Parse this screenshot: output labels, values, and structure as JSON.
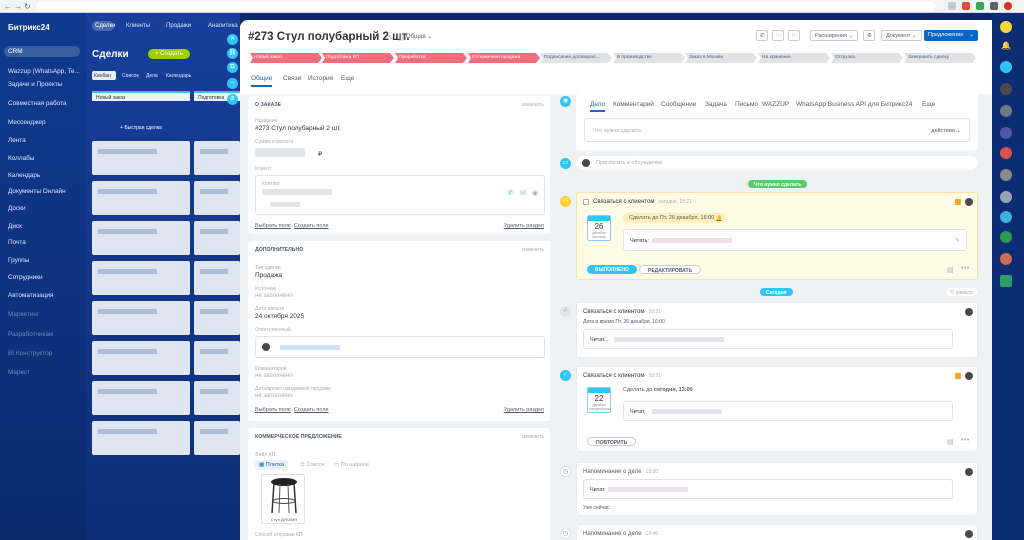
{
  "browser": {
    "nav_back": "←",
    "nav_forward": "→",
    "nav_reload": "↻"
  },
  "sidebar": {
    "logo": "Битрикс24",
    "items": [
      {
        "label": "CRM",
        "active": true
      },
      {
        "label": "Wazzup (WhatsApp, Te..."
      },
      {
        "label": "Задачи и Проекты"
      },
      {
        "label": "Совместная работа"
      },
      {
        "label": "Мессенджер"
      },
      {
        "label": "Лента"
      },
      {
        "label": "Коллабы"
      },
      {
        "label": "Календарь"
      },
      {
        "label": "Документы Онлайн"
      },
      {
        "label": "Доски"
      },
      {
        "label": "Диск"
      },
      {
        "label": "Почта"
      },
      {
        "label": "Группы"
      },
      {
        "label": "Сотрудники"
      },
      {
        "label": "Автоматизация"
      },
      {
        "label": "Маркетинг"
      },
      {
        "label": "Разработчикам"
      },
      {
        "label": "BI Конструктор"
      },
      {
        "label": "Маркет"
      }
    ]
  },
  "crm_bg": {
    "tabs": [
      "Сделки",
      "Клиенты",
      "Продажи",
      "Аналитика"
    ],
    "page_title": "Сделки",
    "create_button": "+ Создать",
    "views": [
      "Канбан",
      "Список",
      "Дела",
      "Календарь"
    ],
    "columns": [
      "Новый заказ",
      "Подготовка"
    ],
    "quick_deal": "+ Быстрая сделка"
  },
  "header": {
    "title": "#273 Стул полубарный 2 шт.",
    "category": "Общая",
    "expansion_label": "Расширения",
    "document_label": "Документ",
    "proposal_label": "Предложение"
  },
  "stages": [
    {
      "label": "Новый заказ",
      "state": "done"
    },
    {
      "label": "Подготовка КП",
      "state": "done"
    },
    {
      "label": "Проработка",
      "state": "done"
    },
    {
      "label": "Отложенная продажа",
      "state": "done"
    },
    {
      "label": "Подписание договора/с...",
      "state": "todo"
    },
    {
      "label": "В производстве",
      "state": "todo"
    },
    {
      "label": "Заказ в Москве",
      "state": "todo"
    },
    {
      "label": "На хранении",
      "state": "todo"
    },
    {
      "label": "Отгрузка",
      "state": "todo"
    },
    {
      "label": "Завершить сделку",
      "state": "todo"
    }
  ],
  "tabs": [
    "Общие",
    "Связи",
    "История",
    "Еще"
  ],
  "about": {
    "title": "О заказе",
    "edit": "изменить",
    "name_label": "Название",
    "name_value": "#273 Стул полубарный 2 шт.",
    "sum_label": "Сумма и валюта",
    "currency": "₽",
    "client_label": "Клиент",
    "contact_label": "Контакт",
    "select_field": "Выбрать поле",
    "create_field": "Создать поле",
    "delete_section": "Удалить раздел"
  },
  "extra": {
    "title": "Дополнительно",
    "edit": "изменить",
    "type_label": "Тип сделки",
    "type_value": "Продажа",
    "source_label": "Источник",
    "empty": "не заполнено",
    "start_label": "Дата начала",
    "start_value": "24 октября 2025",
    "resp_label": "Ответственный",
    "comment_label": "Комментарий",
    "repeat_label": "Дата/время ожидаемой продажи",
    "select_field": "Выбрать поле",
    "create_field": "Создать поле",
    "delete_section": "Удалить раздел"
  },
  "kp": {
    "title": "Коммерческое предложение",
    "edit": "изменить",
    "file_label": "Файл КП",
    "views": [
      "Плитка",
      "Список",
      "По ширине"
    ],
    "file_caption": "Стул ДУБЛИН",
    "send_label": "Способ отправки КП"
  },
  "timeline": {
    "tabs": [
      "Дело",
      "Комментарий",
      "Сообщение",
      "Задача",
      "Письмо",
      "WAZZUP",
      "WhatsApp Business API для Битрикс24",
      "Еще"
    ],
    "placeholder": "Что нужно сделать",
    "actions": "действия",
    "invite_placeholder": "Пригласить в обсуждение",
    "todo_badge": "Что нужно сделать",
    "today_badge": "Сегодня",
    "filter": "фильтр",
    "pinned": {
      "title": "Связаться с клиентом",
      "time": "сегодня, 15:21",
      "deadline": "Сделать до Пт, 26 декабря, 16:00",
      "cal_day": "26",
      "cal_month": "декабря пятница",
      "text": "Читать:",
      "done_button": "ВЫПОЛНЕНО",
      "edit_button": "РЕДАКТИРОВАТЬ"
    },
    "item1": {
      "title": "Связаться с клиентом",
      "time": "15:21",
      "subtitle": "Дата и время Пт, 26 декабря, 16:00",
      "text": "Читат..."
    },
    "item2": {
      "title": "Связаться с клиентом",
      "time": "15:21",
      "deadline_prefix": "Сделать до",
      "deadline_value": "сегодня, 13:00",
      "cal_day": "22",
      "cal_month": "декабря понедельник",
      "text": "Читат,",
      "repeat_button": "ПОВТОРИТЬ"
    },
    "item3": {
      "title": "Напоминание о деле",
      "time": "13:00",
      "text": "Читат.",
      "note": "Уже сейчас"
    },
    "item4": {
      "title": "Напоминание о деле",
      "time": "12:46"
    }
  },
  "colors": {
    "accent": "#2067b0",
    "stage_done": "#f06d79",
    "stage_todo": "#dfe3e6",
    "primary_button": "#0b66c3",
    "cyan": "#2fc6f6",
    "green_badge": "#5cc96a",
    "sidebar_bg": "#0b2a6e"
  }
}
